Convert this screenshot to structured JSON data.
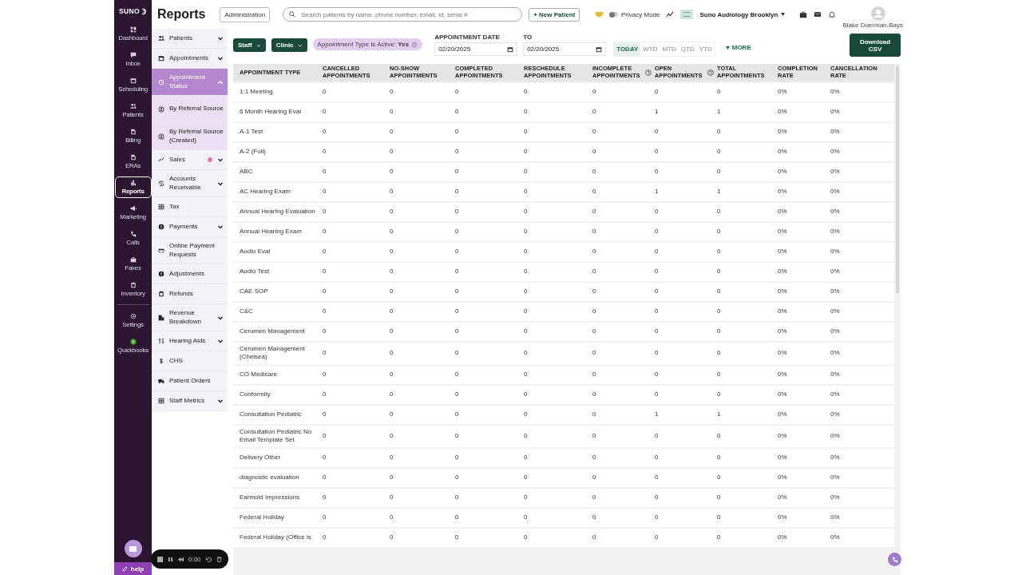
{
  "nav": {
    "logo": "SUNO",
    "items": [
      {
        "label": "Dashboard",
        "selected": false
      },
      {
        "label": "Inbox",
        "selected": false
      },
      {
        "label": "Scheduling",
        "selected": false
      },
      {
        "label": "Patients",
        "selected": false
      },
      {
        "label": "Billing",
        "selected": false
      },
      {
        "label": "ERAs",
        "selected": false
      },
      {
        "label": "Reports",
        "selected": true
      },
      {
        "label": "Marketing",
        "selected": false
      },
      {
        "label": "Calls",
        "selected": false
      },
      {
        "label": "Faxes",
        "selected": false
      },
      {
        "label": "Inventory",
        "selected": false
      },
      {
        "label": "Settings",
        "selected": false
      },
      {
        "label": "Quickbooks",
        "selected": false
      }
    ],
    "help": "help"
  },
  "header": {
    "title": "Reports",
    "admin_button": "Administration",
    "search": {
      "placeholder": "Search patients by name, phone number, email, id, serial #"
    },
    "new_patient": "+ New Patient",
    "privacy": {
      "label": "Privacy Mode",
      "on": false
    },
    "clinic": "Suno Audiology Brooklyn",
    "user": "Blake Doerman-Bays"
  },
  "report_menu": [
    {
      "label": "Patients",
      "kind": "group",
      "expanded": false,
      "selected": false
    },
    {
      "label": "Appointments",
      "kind": "group",
      "expanded": false,
      "selected": false
    },
    {
      "label": "Appointment Status",
      "kind": "group",
      "expanded": true,
      "selected": true,
      "children": [
        {
          "label": "By Referral Source",
          "selected": false
        },
        {
          "label": "By Referral Source (Created)",
          "selected": false
        }
      ]
    },
    {
      "label": "Sales",
      "kind": "group",
      "expanded": false,
      "selected": false
    },
    {
      "label": "Accounts Receivable",
      "kind": "group",
      "expanded": false,
      "selected": false
    },
    {
      "label": "Tax",
      "kind": "link",
      "selected": false
    },
    {
      "label": "Payments",
      "kind": "group",
      "expanded": false,
      "selected": false
    },
    {
      "label": "Online Payment Requests",
      "kind": "link",
      "selected": false
    },
    {
      "label": "Adjustments",
      "kind": "link",
      "selected": false
    },
    {
      "label": "Refunds",
      "kind": "link",
      "selected": false
    },
    {
      "label": "Revenue Breakdown",
      "kind": "group",
      "expanded": false,
      "selected": false
    },
    {
      "label": "Hearing Aids",
      "kind": "group",
      "expanded": false,
      "selected": false
    },
    {
      "label": "CHS",
      "kind": "link",
      "selected": false
    },
    {
      "label": "Patient Orders",
      "kind": "link",
      "selected": false
    },
    {
      "label": "Staff Metrics",
      "kind": "group",
      "expanded": false,
      "selected": false
    }
  ],
  "filters": {
    "dropdowns": [
      "Staff",
      "Clinic"
    ],
    "chip": "Appointment Type Is Active: **Yes**",
    "date_from": {
      "label": "APPOINTMENT DATE",
      "value": "02/20/2025"
    },
    "date_to": {
      "label": "TO",
      "value": "02/20/2025"
    },
    "ranges": [
      {
        "label": "TODAY",
        "selected": true
      },
      {
        "label": "WTD",
        "selected": false
      },
      {
        "label": "MTD",
        "selected": false
      },
      {
        "label": "QTD",
        "selected": false
      },
      {
        "label": "YTD",
        "selected": false
      }
    ],
    "more": "MORE",
    "download": "Download CSV"
  },
  "table": {
    "columns": [
      {
        "label": "APPOINTMENT TYPE",
        "help": false
      },
      {
        "label": "CANCELLED APPOINTMENTS",
        "help": false
      },
      {
        "label": "NO-SHOW APPOINTMENTS",
        "help": false
      },
      {
        "label": "COMPLETED APPOINTMENTS",
        "help": false
      },
      {
        "label": "RESCHEDULE APPOINTMENTS",
        "help": false
      },
      {
        "label": "INCOMPLETE APPOINTMENTS",
        "help": true
      },
      {
        "label": "OPEN APPOINTMENTS",
        "help": true
      },
      {
        "label": "TOTAL APPOINTMENTS",
        "help": false
      },
      {
        "label": "COMPLETION RATE",
        "help": false
      },
      {
        "label": "CANCELLATION RATE",
        "help": false
      }
    ],
    "rows": [
      [
        "1:1 Meeting",
        "0",
        "0",
        "0",
        "0",
        "0",
        "0",
        "0",
        "0%",
        "0%"
      ],
      [
        "6 Month Hearing Eval",
        "0",
        "0",
        "0",
        "0",
        "0",
        "1",
        "1",
        "0%",
        "0%"
      ],
      [
        "A-1 Test",
        "0",
        "0",
        "0",
        "0",
        "0",
        "0",
        "0",
        "0%",
        "0%"
      ],
      [
        "A-2 (Full)",
        "0",
        "0",
        "0",
        "0",
        "0",
        "0",
        "0",
        "0%",
        "0%"
      ],
      [
        "ABC",
        "0",
        "0",
        "0",
        "0",
        "0",
        "0",
        "0",
        "0%",
        "0%"
      ],
      [
        "AC Hearing Exam",
        "0",
        "0",
        "0",
        "0",
        "0",
        "1",
        "1",
        "0%",
        "0%"
      ],
      [
        "Annual Hearing Evaluation",
        "0",
        "0",
        "0",
        "0",
        "0",
        "0",
        "0",
        "0%",
        "0%"
      ],
      [
        "Annual Hearing Exam",
        "0",
        "0",
        "0",
        "0",
        "0",
        "0",
        "0",
        "0%",
        "0%"
      ],
      [
        "Audio Eval",
        "0",
        "0",
        "0",
        "0",
        "0",
        "0",
        "0",
        "0%",
        "0%"
      ],
      [
        "Audio Test",
        "0",
        "0",
        "0",
        "0",
        "0",
        "0",
        "0",
        "0%",
        "0%"
      ],
      [
        "CAE SOP",
        "0",
        "0",
        "0",
        "0",
        "0",
        "0",
        "0",
        "0%",
        "0%"
      ],
      [
        "C&C",
        "0",
        "0",
        "0",
        "0",
        "0",
        "0",
        "0",
        "0%",
        "0%"
      ],
      [
        "Cerumen Management",
        "0",
        "0",
        "0",
        "0",
        "0",
        "0",
        "0",
        "0%",
        "0%"
      ],
      [
        "Cerumen Management (Chelsea)",
        "0",
        "0",
        "0",
        "0",
        "0",
        "0",
        "0",
        "0%",
        "0%"
      ],
      [
        "CO Medicare",
        "0",
        "0",
        "0",
        "0",
        "0",
        "0",
        "0",
        "0%",
        "0%"
      ],
      [
        "Conformity",
        "0",
        "0",
        "0",
        "0",
        "0",
        "0",
        "0",
        "0%",
        "0%"
      ],
      [
        "Consultation Pediatric",
        "0",
        "0",
        "0",
        "0",
        "0",
        "1",
        "1",
        "0%",
        "0%"
      ],
      [
        "Consultation Pediatric No Email Template Set",
        "0",
        "0",
        "0",
        "0",
        "0",
        "0",
        "0",
        "0%",
        "0%"
      ],
      [
        "Delivery Other",
        "0",
        "0",
        "0",
        "0",
        "0",
        "0",
        "0",
        "0%",
        "0%"
      ],
      [
        "diagnostic evaluation",
        "0",
        "0",
        "0",
        "0",
        "0",
        "0",
        "0",
        "0%",
        "0%"
      ],
      [
        "Earmold Impressions",
        "0",
        "0",
        "0",
        "0",
        "0",
        "0",
        "0",
        "0%",
        "0%"
      ],
      [
        "Federal Holiday",
        "0",
        "0",
        "0",
        "0",
        "0",
        "0",
        "0",
        "0%",
        "0%"
      ],
      [
        "Federal Holiday (Office is",
        "0",
        "0",
        "0",
        "0",
        "0",
        "0",
        "0",
        "0%",
        "0%"
      ]
    ]
  },
  "recorder": {
    "time": "0:00"
  }
}
